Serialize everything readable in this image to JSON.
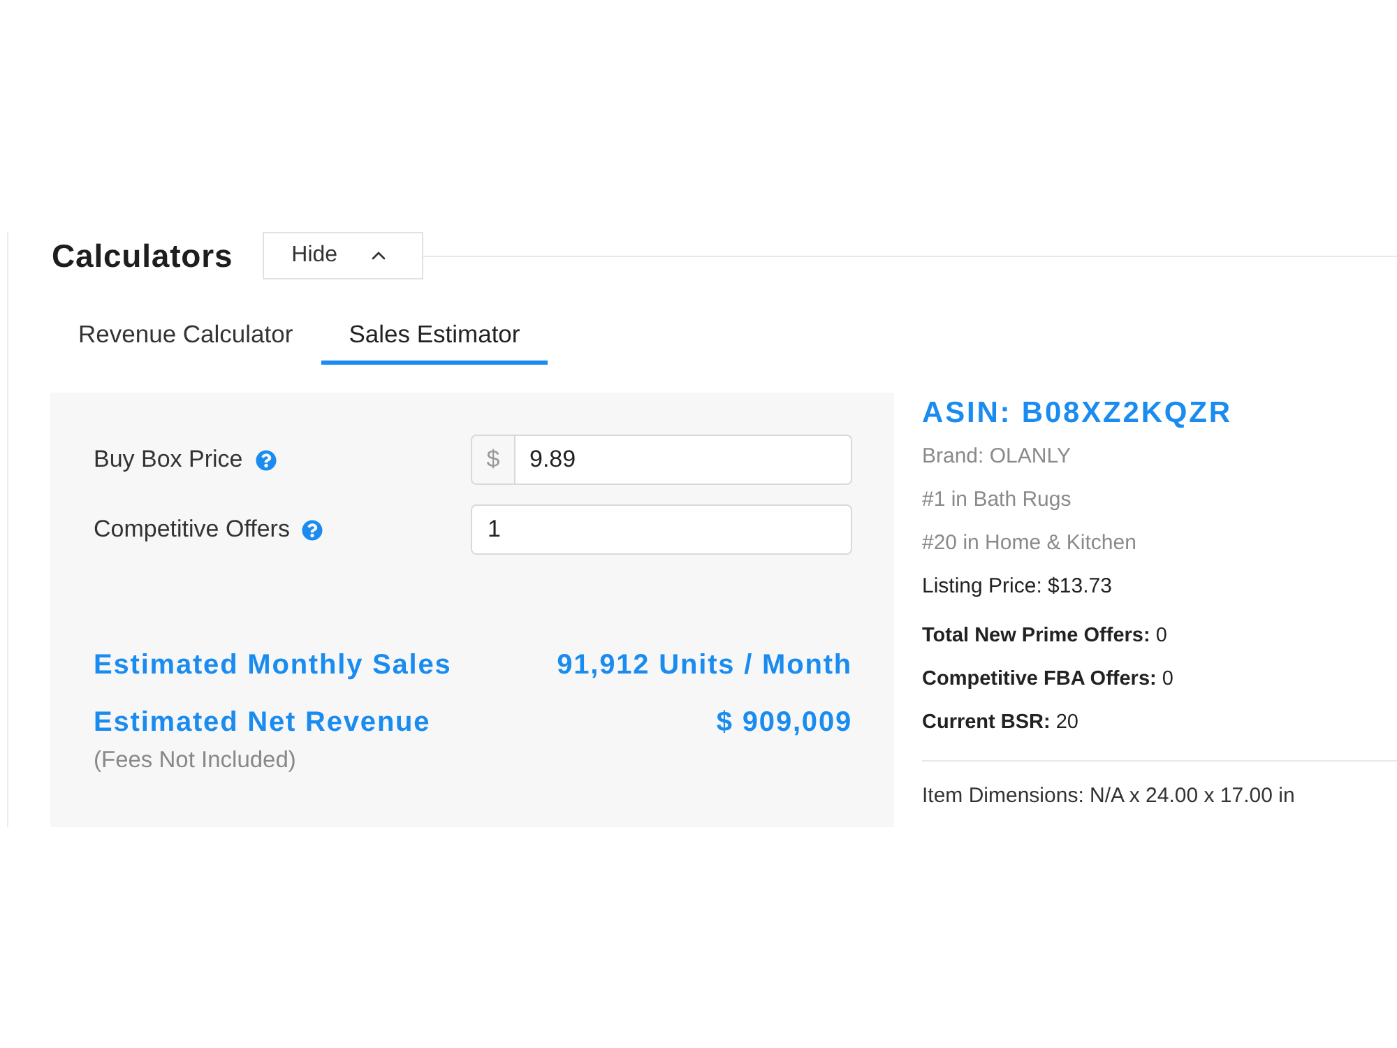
{
  "section": {
    "title": "Calculators",
    "toggle": {
      "label": "Hide",
      "expanded": true
    }
  },
  "tabs": [
    {
      "label": "Revenue Calculator",
      "selected": false
    },
    {
      "label": "Sales Estimator",
      "selected": true
    }
  ],
  "form": {
    "fields": [
      {
        "label": "Buy Box Price",
        "prefix": "$",
        "value": "9.89"
      },
      {
        "label": "Competitive Offers",
        "value": "1"
      }
    ]
  },
  "results": [
    {
      "label": "Estimated Monthly Sales",
      "value": "91,912 Units / Month"
    },
    {
      "label": "Estimated Net Revenue",
      "value": "$ 909,009",
      "note": "(Fees Not Included)"
    }
  ],
  "product": {
    "asin": "ASIN: B08XZ2KQZR",
    "details": [
      {
        "text": "Brand: OLANLY",
        "kind": "muted"
      },
      {
        "text": "#1 in Bath Rugs",
        "kind": "muted"
      },
      {
        "text": "#20 in Home & Kitchen",
        "kind": "muted"
      },
      {
        "text": "Listing Price: $13.73",
        "kind": "plain"
      }
    ],
    "offers": [
      "**Total New Prime Offers:** 0",
      "**Competitive FBA Offers:** 0",
      "**Current BSR:** 20"
    ],
    "dimensions": "Item Dimensions: N/A x 24.00 x 17.00 in"
  }
}
